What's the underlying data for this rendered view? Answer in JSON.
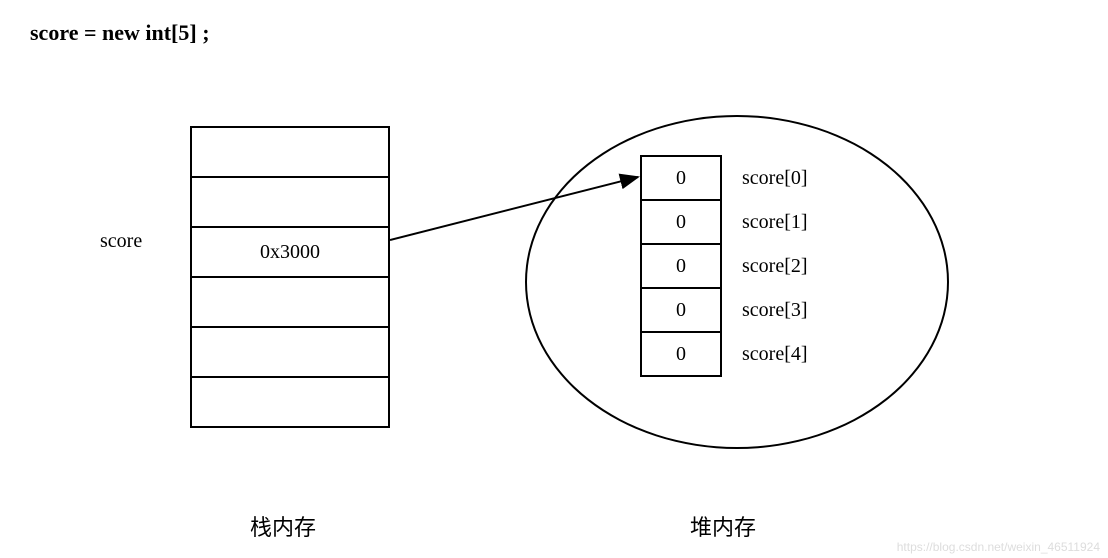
{
  "code": "score = new int[5] ;",
  "stack": {
    "variableLabel": "score",
    "cells": [
      "",
      "",
      "0x3000",
      "",
      "",
      ""
    ],
    "title": "栈内存"
  },
  "heap": {
    "title": "堆内存",
    "rows": [
      {
        "value": "0",
        "label": "score[0]"
      },
      {
        "value": "0",
        "label": "score[1]"
      },
      {
        "value": "0",
        "label": "score[2]"
      },
      {
        "value": "0",
        "label": "score[3]"
      },
      {
        "value": "0",
        "label": "score[4]"
      }
    ]
  },
  "watermark": "https://blog.csdn.net/weixin_46511924"
}
